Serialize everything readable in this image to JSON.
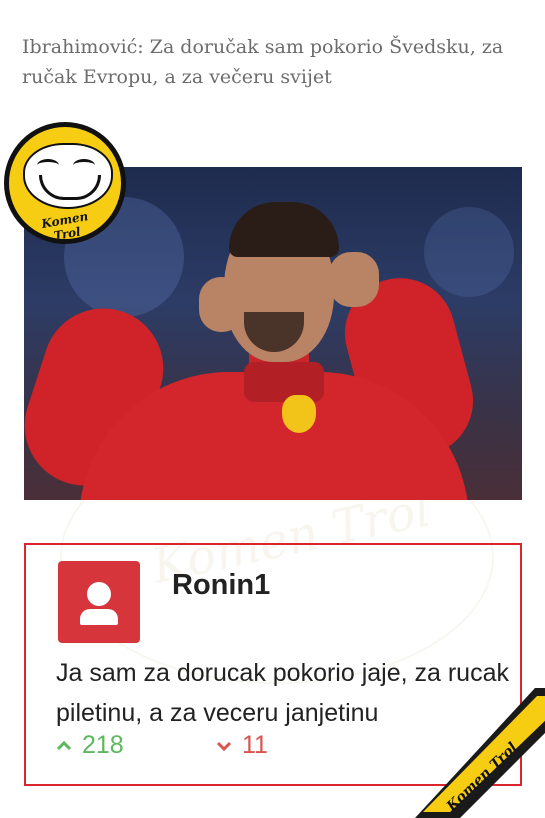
{
  "article": {
    "headline": "Ibrahimović: Za doručak sam pokorio Švedsku, za ručak Evropu, a za večeru svijet"
  },
  "brand": {
    "logo_text": "Komen Trol",
    "accent": "#d9252b",
    "badge_color": "#f6cd12"
  },
  "comment": {
    "username": "Ronin1",
    "text": "Ja sam za dorucak pokorio jaje, za rucak piletinu, a za veceru janjetinu",
    "upvotes": "218",
    "downvotes": "11",
    "upvote_color": "#5cb85c",
    "downvote_color": "#d9534f",
    "avatar_icon": "user-icon"
  }
}
